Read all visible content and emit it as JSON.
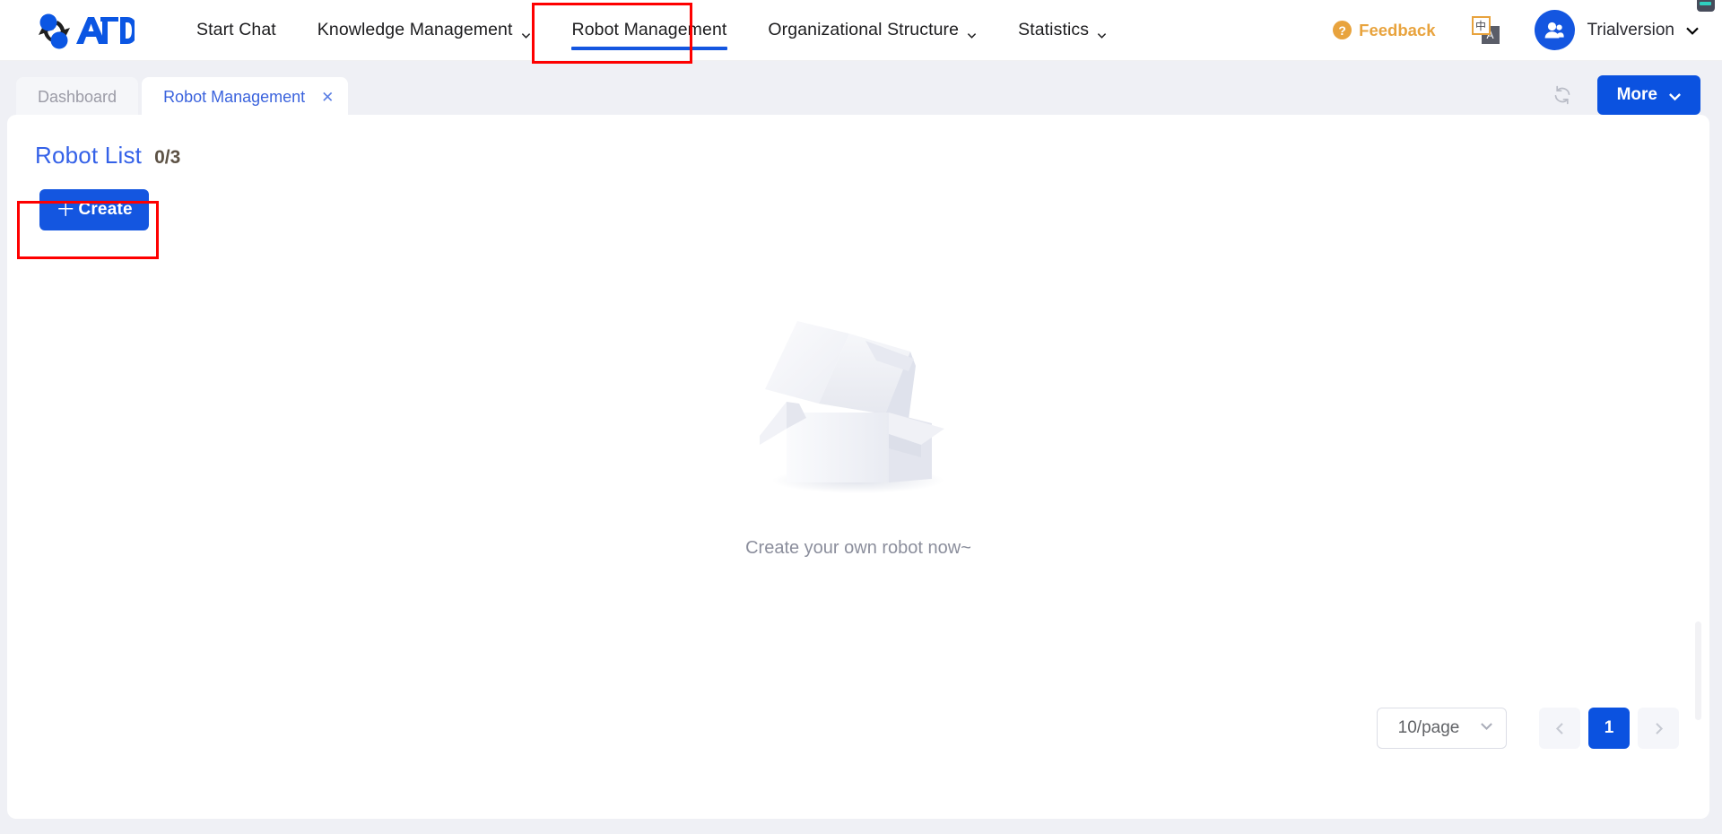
{
  "header": {
    "logo": {
      "name": "aid-logo",
      "text": "AID"
    },
    "nav": [
      {
        "label": "Start Chat",
        "has_caret": false,
        "active": false
      },
      {
        "label": "Knowledge Management",
        "has_caret": true,
        "active": false
      },
      {
        "label": "Robot Management",
        "has_caret": false,
        "active": true
      },
      {
        "label": "Organizational Structure",
        "has_caret": true,
        "active": false
      },
      {
        "label": "Statistics",
        "has_caret": true,
        "active": false
      }
    ],
    "feedback": {
      "label": "Feedback",
      "icon": "question-mark-circle-icon"
    },
    "language_switch": {
      "cn": "中",
      "en": "A",
      "icon": "language-switch-icon"
    },
    "user": {
      "name": "Trialversion",
      "avatar_icon": "user-avatar-icon",
      "caret_icon": "chevron-down-icon"
    }
  },
  "tabbar": {
    "tabs": [
      {
        "label": "Dashboard",
        "active": false,
        "closable": false
      },
      {
        "label": "Robot Management",
        "active": true,
        "closable": true,
        "close_icon": "close-icon"
      }
    ],
    "refresh_icon": "refresh-icon",
    "more_button": {
      "label": "More",
      "caret_icon": "chevron-down-icon"
    }
  },
  "main": {
    "list_title": "Robot List",
    "list_count": "0/3",
    "create_button": {
      "plus": "＋",
      "label": "Create"
    },
    "empty_state": {
      "illustration": "empty-box-illustration",
      "text": "Create your own robot now~"
    }
  },
  "pagination": {
    "page_size": "10/page",
    "page_size_caret": "chevron-down-icon",
    "prev_icon": "chevron-left-icon",
    "next_icon": "chevron-right-icon",
    "current_page": "1"
  },
  "colors": {
    "brand_blue": "#1456e0",
    "accent_orange": "#e8a33d",
    "highlight_red": "#fe0000",
    "page_bg": "#eff0f5",
    "tab_active_text": "#3b63dd"
  }
}
